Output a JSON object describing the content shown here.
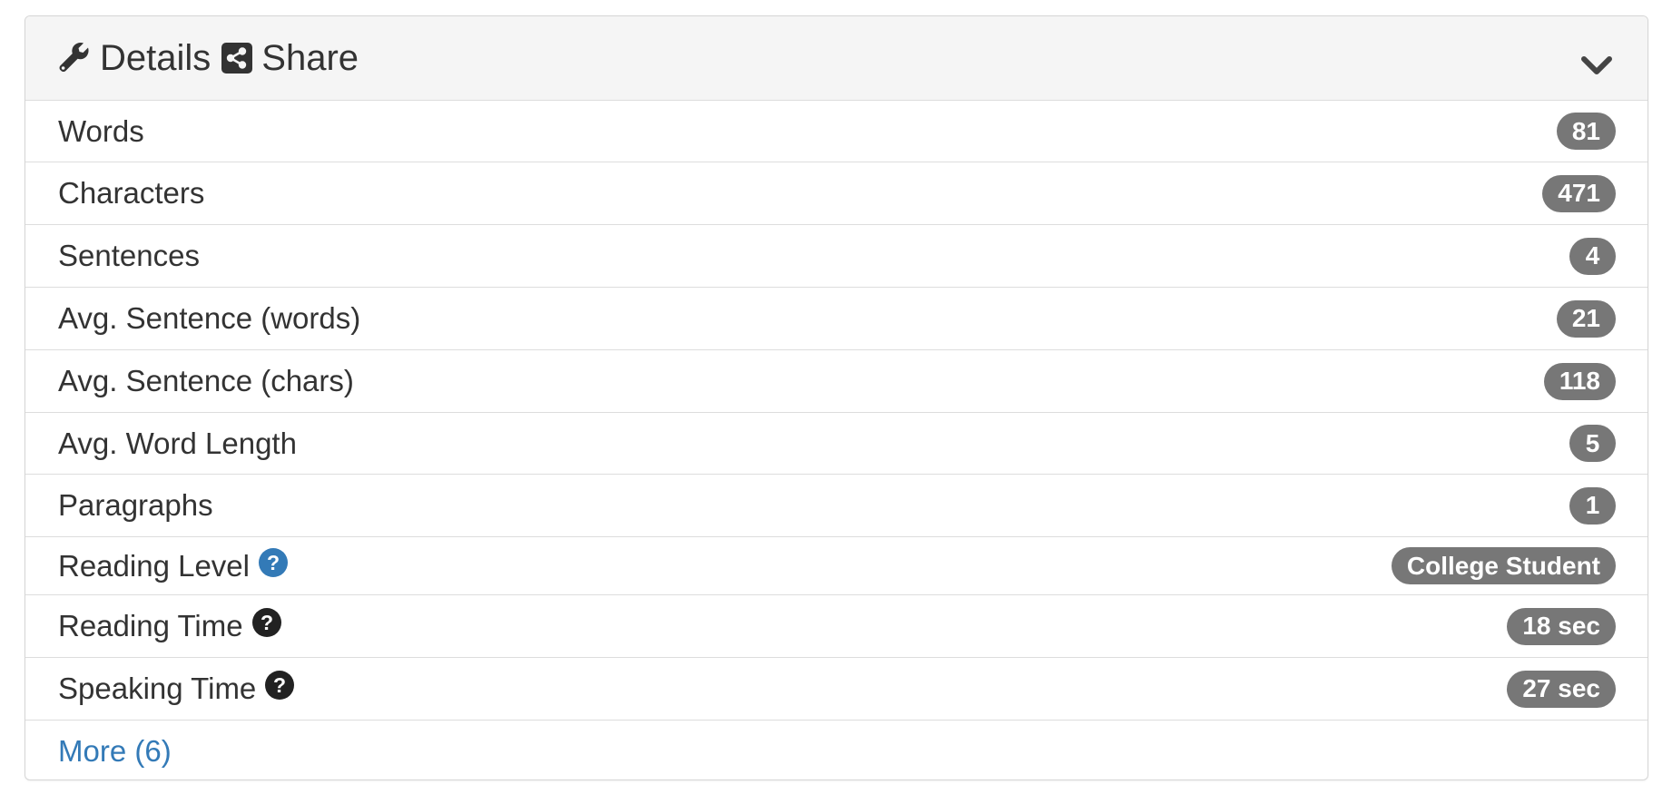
{
  "header": {
    "details_label": "Details",
    "share_label": "Share",
    "details_icon": "wrench-icon",
    "share_icon": "share-square-icon",
    "toggle_icon": "chevron-down-icon"
  },
  "rows": [
    {
      "label": "Words",
      "value": "81"
    },
    {
      "label": "Characters",
      "value": "471"
    },
    {
      "label": "Sentences",
      "value": "4"
    },
    {
      "label": "Avg. Sentence (words)",
      "value": "21"
    },
    {
      "label": "Avg. Sentence (chars)",
      "value": "118"
    },
    {
      "label": "Avg. Word Length",
      "value": "5"
    },
    {
      "label": "Paragraphs",
      "value": "1"
    },
    {
      "label": "Reading Level",
      "value": "College Student",
      "help": "question-circle-icon",
      "help_color": "#337ab7"
    },
    {
      "label": "Reading Time",
      "value": "18 sec",
      "help": "question-circle-icon",
      "help_color": "#222222"
    },
    {
      "label": "Speaking Time",
      "value": "27 sec",
      "help": "question-circle-icon",
      "help_color": "#222222"
    }
  ],
  "more_link": "More (6)",
  "colors": {
    "badge_bg": "#777777",
    "link": "#337ab7",
    "heading_bg": "#f5f5f5",
    "text": "#333333"
  }
}
